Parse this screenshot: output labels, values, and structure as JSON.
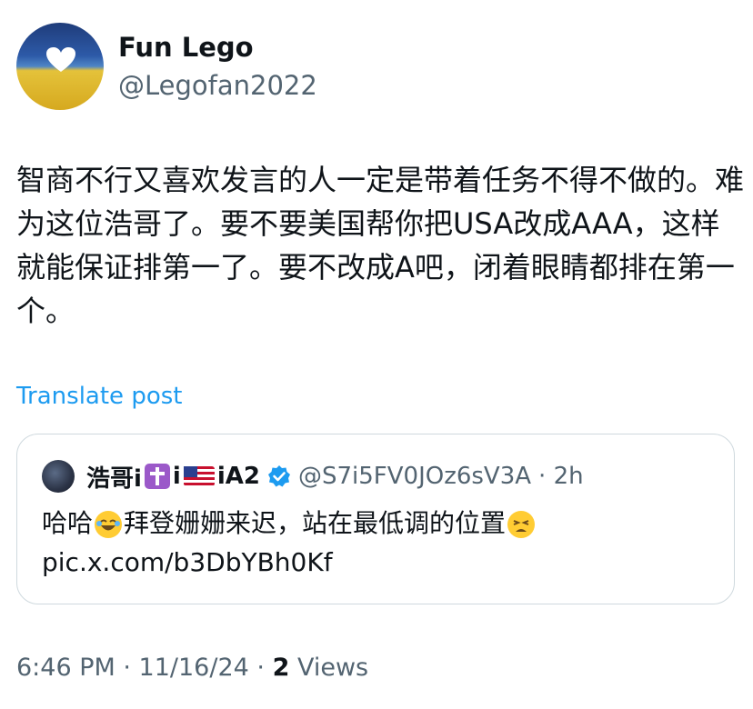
{
  "author": {
    "name": "Fun Lego",
    "handle": "@Legofan2022"
  },
  "tweet": {
    "text": "智商不行又喜欢发言的人一定是带着任务不得不做的。难为这位浩哥了。要不要美国帮你把USA改成AAA，这样就能保证排第一了。要不改成A吧，闭着眼睛都排在第一个。",
    "translate_label": "Translate post"
  },
  "quote": {
    "name_part1": "浩哥i",
    "name_part2": "i",
    "name_part3": "iA2",
    "handle": "@S7i5FV0JOz6sV3A",
    "time": "· 2h",
    "text_part1": "哈哈",
    "text_part2": "拜登姗姗来迟，站在最低调的位置",
    "link": "pic.x.com/b3DbYBh0Kf",
    "emojis": [
      "cross-emoji",
      "us-flag-emoji",
      "laughing-emoji",
      "weary-emoji"
    ],
    "verified_color": "#1d9bf0"
  },
  "meta": {
    "time": "6:46 PM",
    "date": "· 11/16/24 ·",
    "views_count": "2",
    "views_label": "Views"
  },
  "colors": {
    "text": "#0f1419",
    "secondary": "#536471",
    "link": "#1d9bf0",
    "border": "#cfd9de"
  }
}
